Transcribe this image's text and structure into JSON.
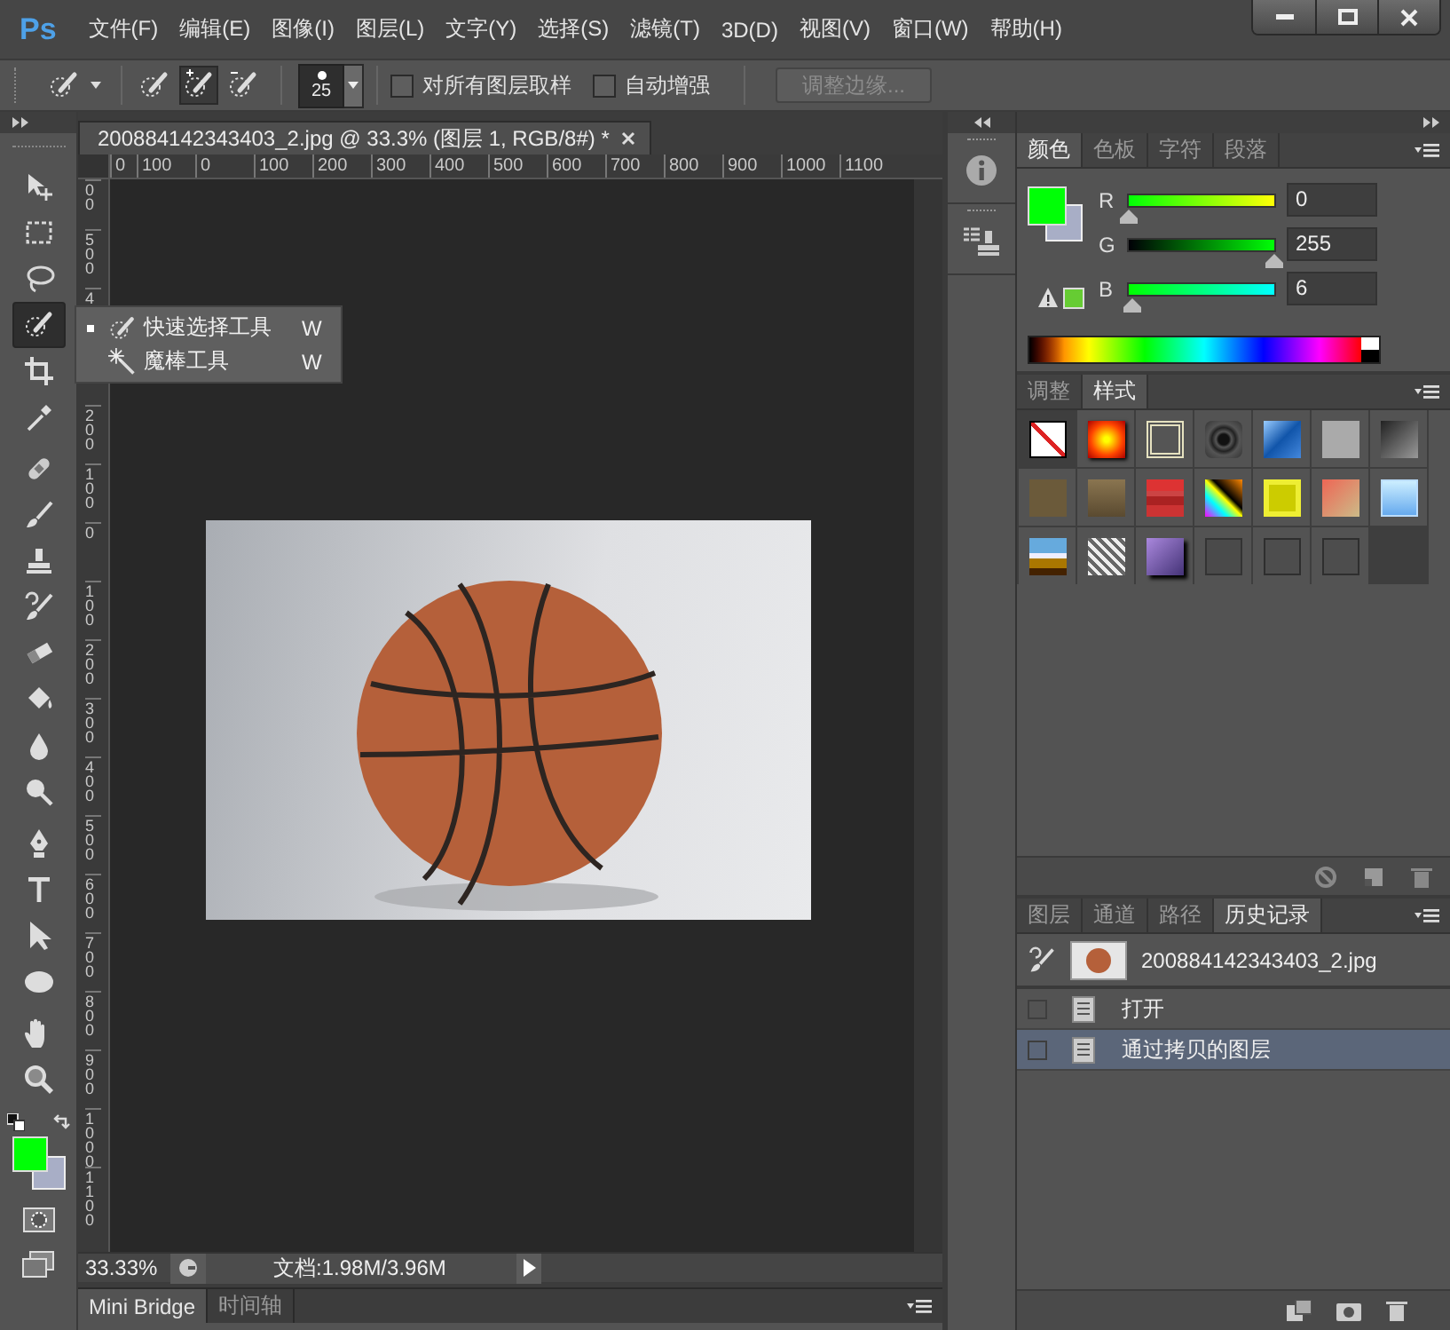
{
  "app": {
    "logo": "Ps"
  },
  "menu": [
    "文件(F)",
    "编辑(E)",
    "图像(I)",
    "图层(L)",
    "文字(Y)",
    "选择(S)",
    "滤镜(T)",
    "3D(D)",
    "视图(V)",
    "窗口(W)",
    "帮助(H)"
  ],
  "options_bar": {
    "selection_modes": [
      {
        "selected": false
      },
      {
        "selected": true
      },
      {
        "selected": false
      }
    ],
    "brush_size": "25",
    "checkboxes": [
      {
        "label": "对所有图层取样",
        "checked": false
      },
      {
        "label": "自动增强",
        "checked": false
      }
    ],
    "refine_edge_button": {
      "label": "调整边缘...",
      "disabled": true
    }
  },
  "tools": [
    {
      "kind": "move",
      "selected": false
    },
    {
      "kind": "marquee",
      "selected": false
    },
    {
      "kind": "lasso",
      "selected": false
    },
    {
      "kind": "quick_select",
      "selected": true
    },
    {
      "kind": "crop",
      "selected": false
    },
    {
      "kind": "eyedropper",
      "selected": false
    },
    {
      "kind": "heal",
      "selected": false
    },
    {
      "kind": "brush",
      "selected": false
    },
    {
      "kind": "stamp",
      "selected": false
    },
    {
      "kind": "history_brush",
      "selected": false
    },
    {
      "kind": "eraser",
      "selected": false
    },
    {
      "kind": "bucket",
      "selected": false
    },
    {
      "kind": "blur",
      "selected": false
    },
    {
      "kind": "dodge",
      "selected": false
    },
    {
      "kind": "pen",
      "selected": false
    },
    {
      "kind": "type",
      "selected": false
    },
    {
      "kind": "path_select",
      "selected": false
    },
    {
      "kind": "ellipse",
      "selected": false
    },
    {
      "kind": "hand",
      "selected": false
    },
    {
      "kind": "zoom",
      "selected": false
    }
  ],
  "tool_flyout": [
    {
      "label": "快速选择工具",
      "shortcut": "W",
      "selected": true
    },
    {
      "label": "魔棒工具",
      "shortcut": "W",
      "selected": false
    }
  ],
  "document": {
    "tab_title": "200884142343403_2.jpg @ 33.3% (图层 1, RGB/8#) *",
    "ruler_h": [
      "0",
      "100",
      "0",
      "100",
      "200",
      "300",
      "400",
      "500",
      "600",
      "700",
      "800",
      "900",
      "1000",
      "1100"
    ],
    "ruler_v": [
      "00",
      "500",
      "4",
      "200",
      "100",
      "0",
      "100",
      "200",
      "300",
      "400",
      "500",
      "600",
      "700",
      "800",
      "900",
      "1000",
      "1100"
    ],
    "zoom": "33.33%",
    "doc_info": "文档:1.98M/3.96M"
  },
  "bottom_tabs": [
    {
      "label": "Mini Bridge",
      "selected": true
    },
    {
      "label": "时间轴",
      "selected": false
    }
  ],
  "color_panel": {
    "tabs": [
      {
        "label": "颜色",
        "selected": true
      },
      {
        "label": "色板",
        "selected": false
      },
      {
        "label": "字符",
        "selected": false
      },
      {
        "label": "段落",
        "selected": false
      }
    ],
    "channels": [
      {
        "label": "R",
        "value": "0",
        "level": 0
      },
      {
        "label": "G",
        "value": "255",
        "level": 1
      },
      {
        "label": "B",
        "value": "6",
        "level": 0.0235
      }
    ]
  },
  "styles_panel": {
    "tabs": [
      {
        "label": "调整",
        "selected": false
      },
      {
        "label": "样式",
        "selected": true
      }
    ]
  },
  "history_panel": {
    "tabs": [
      {
        "label": "图层",
        "selected": false
      },
      {
        "label": "通道",
        "selected": false
      },
      {
        "label": "路径",
        "selected": false
      },
      {
        "label": "历史记录",
        "selected": true
      }
    ],
    "snapshot": {
      "label": "200884142343403_2.jpg"
    },
    "states": [
      {
        "label": "打开",
        "selected": false
      },
      {
        "label": "通过拷贝的图层",
        "selected": true
      }
    ]
  }
}
